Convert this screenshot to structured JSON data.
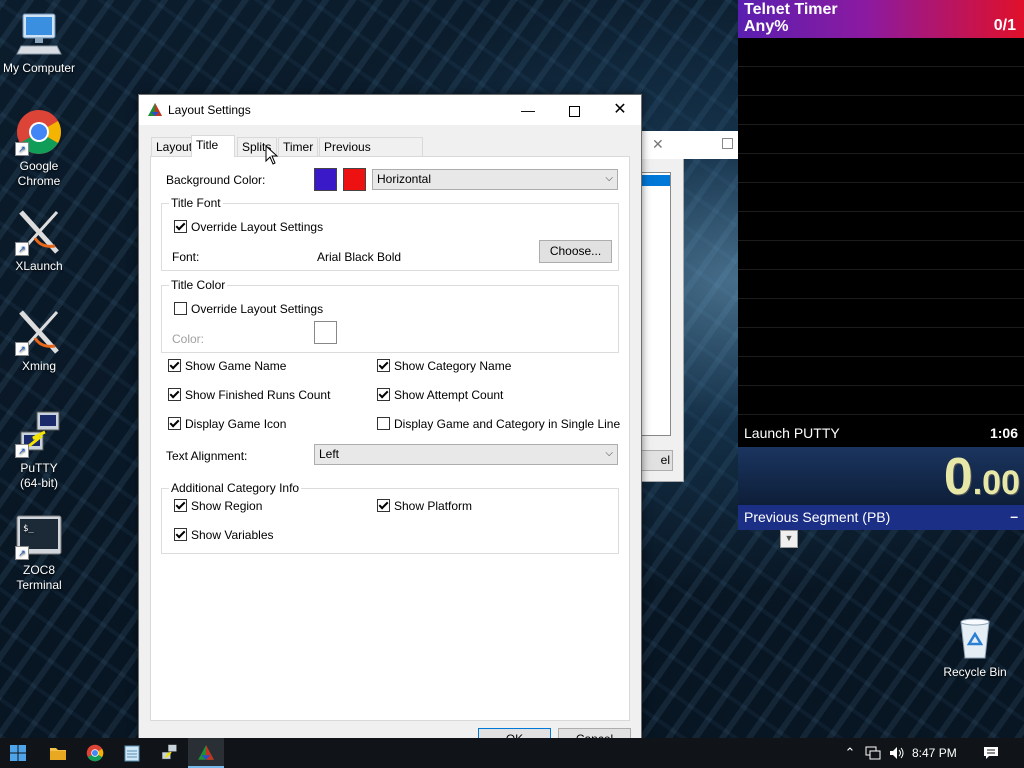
{
  "desktop": {
    "icons": [
      {
        "label1": "My Computer",
        "label2": ""
      },
      {
        "label1": "Google",
        "label2": "Chrome"
      },
      {
        "label1": "XLaunch",
        "label2": ""
      },
      {
        "label1": "Xming",
        "label2": ""
      },
      {
        "label1": "PuTTY",
        "label2": "(64-bit)"
      },
      {
        "label1": "ZOC8",
        "label2": "Terminal"
      }
    ],
    "recycle_bin": "Recycle Bin"
  },
  "background_window": {
    "cancel_fragment": "el"
  },
  "dialog": {
    "title": "Layout Settings",
    "tabs": [
      "Layout",
      "Title",
      "Splits",
      "Timer",
      "Previous Segment"
    ],
    "active_tab": "Title",
    "background_color_label": "Background Color:",
    "background_color1": "#3a1ac8",
    "background_color2": "#ee1111",
    "gradient_value": "Horizontal",
    "title_font_group": "Title Font",
    "override_font_label": "Override Layout Settings",
    "font_label": "Font:",
    "font_value": "Arial Black Bold",
    "choose_button": "Choose...",
    "title_color_group": "Title Color",
    "override_color_label": "Override Layout Settings",
    "color_label": "Color:",
    "checks": {
      "show_game_name": "Show Game Name",
      "show_category_name": "Show Category Name",
      "show_finished_runs": "Show Finished Runs Count",
      "show_attempt_count": "Show Attempt Count",
      "display_game_icon": "Display Game Icon",
      "single_line": "Display Game and Category in Single Line"
    },
    "text_alignment_label": "Text Alignment:",
    "text_alignment_value": "Left",
    "additional_group": "Additional Category Info",
    "show_region": "Show Region",
    "show_platform": "Show Platform",
    "show_variables": "Show Variables",
    "ok_button": "OK",
    "cancel_button": "Cancel"
  },
  "timer": {
    "game": "Telnet Timer",
    "category": "Any%",
    "attempts": "0/1",
    "split_name": "Launch PUTTY",
    "split_time": "1:06",
    "main_time_big": "0",
    "main_time_small": ".00",
    "prev_segment_label": "Previous Segment (PB)",
    "prev_segment_value": "–"
  },
  "taskbar": {
    "time": "8:47 PM"
  }
}
